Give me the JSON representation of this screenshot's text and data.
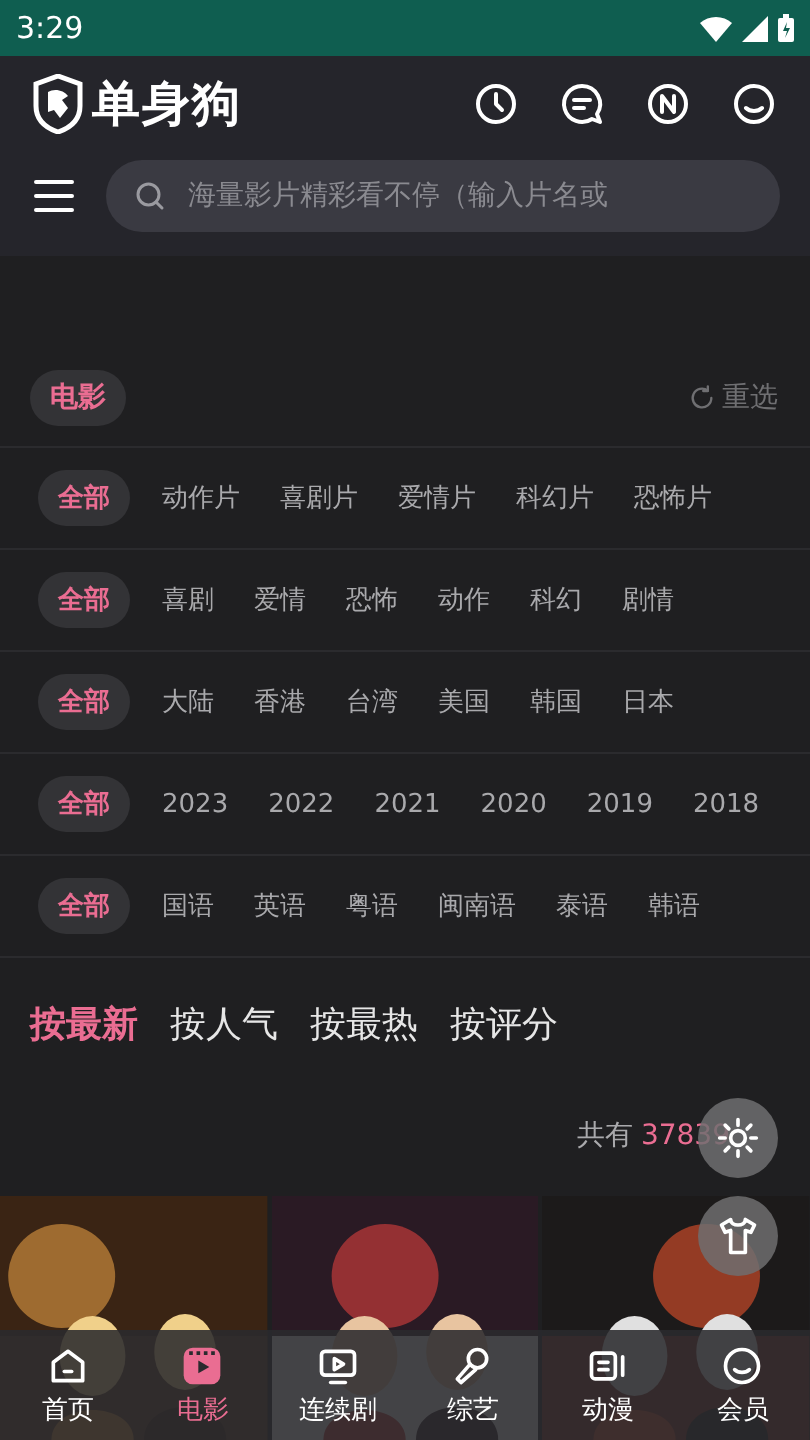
{
  "status_bar": {
    "time": "3:29"
  },
  "header": {
    "logo_text": "单身狗"
  },
  "search": {
    "placeholder": "海量影片精彩看不停（输入片名或"
  },
  "category": {
    "label": "电影",
    "reset": "重选"
  },
  "filters": [
    {
      "options": [
        {
          "label": "全部",
          "selected": true
        },
        {
          "label": "动作片",
          "selected": false
        },
        {
          "label": "喜剧片",
          "selected": false
        },
        {
          "label": "爱情片",
          "selected": false
        },
        {
          "label": "科幻片",
          "selected": false
        },
        {
          "label": "恐怖片",
          "selected": false
        }
      ]
    },
    {
      "options": [
        {
          "label": "全部",
          "selected": true
        },
        {
          "label": "喜剧",
          "selected": false
        },
        {
          "label": "爱情",
          "selected": false
        },
        {
          "label": "恐怖",
          "selected": false
        },
        {
          "label": "动作",
          "selected": false
        },
        {
          "label": "科幻",
          "selected": false
        },
        {
          "label": "剧情",
          "selected": false
        }
      ]
    },
    {
      "options": [
        {
          "label": "全部",
          "selected": true
        },
        {
          "label": "大陆",
          "selected": false
        },
        {
          "label": "香港",
          "selected": false
        },
        {
          "label": "台湾",
          "selected": false
        },
        {
          "label": "美国",
          "selected": false
        },
        {
          "label": "韩国",
          "selected": false
        },
        {
          "label": "日本",
          "selected": false
        }
      ]
    },
    {
      "options": [
        {
          "label": "全部",
          "selected": true
        },
        {
          "label": "2023",
          "selected": false
        },
        {
          "label": "2022",
          "selected": false
        },
        {
          "label": "2021",
          "selected": false
        },
        {
          "label": "2020",
          "selected": false
        },
        {
          "label": "2019",
          "selected": false
        },
        {
          "label": "2018",
          "selected": false
        }
      ]
    },
    {
      "options": [
        {
          "label": "全部",
          "selected": true
        },
        {
          "label": "国语",
          "selected": false
        },
        {
          "label": "英语",
          "selected": false
        },
        {
          "label": "粤语",
          "selected": false
        },
        {
          "label": "闽南语",
          "selected": false
        },
        {
          "label": "泰语",
          "selected": false
        },
        {
          "label": "韩语",
          "selected": false
        }
      ]
    }
  ],
  "sort": [
    {
      "label": "按最新",
      "selected": true
    },
    {
      "label": "按人气",
      "selected": false
    },
    {
      "label": "按最热",
      "selected": false
    },
    {
      "label": "按评分",
      "selected": false
    }
  ],
  "count": {
    "prefix": "共有",
    "value": "37839"
  },
  "bottom_nav": [
    {
      "label": "首页",
      "selected": false
    },
    {
      "label": "电影",
      "selected": true
    },
    {
      "label": "连续剧",
      "selected": false
    },
    {
      "label": "综艺",
      "selected": false
    },
    {
      "label": "动漫",
      "selected": false
    },
    {
      "label": "会员",
      "selected": false
    }
  ]
}
